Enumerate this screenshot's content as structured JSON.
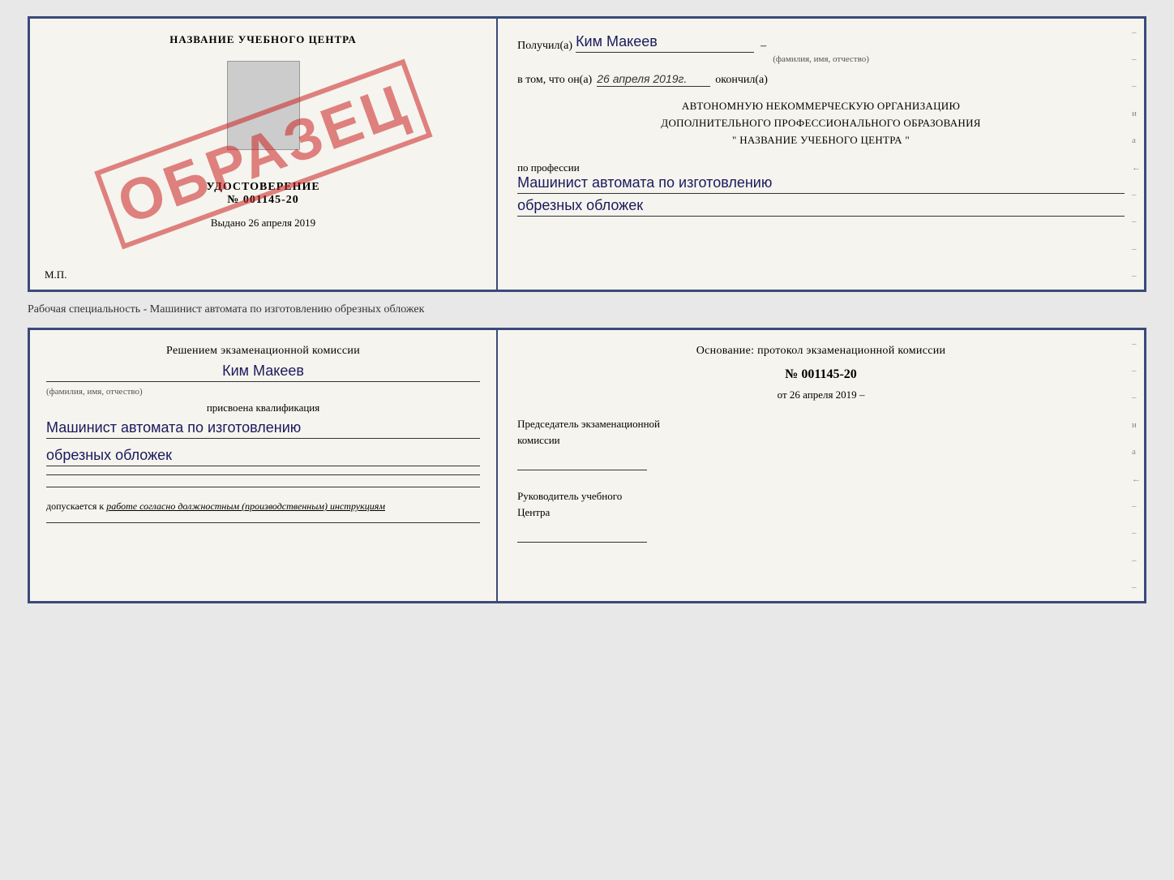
{
  "top_cert": {
    "left": {
      "title": "НАЗВАНИЕ УЧЕБНОГО ЦЕНТРА",
      "stamp_text": "ОБРАЗЕЦ",
      "udostoverenie_label": "УДОСТОВЕРЕНИЕ",
      "number": "№ 001145-20",
      "vydano_prefix": "Выдано",
      "vydano_date": "26 апреля 2019",
      "mp_label": "М.П."
    },
    "right": {
      "poluchil_prefix": "Получил(а)",
      "recipient_name": "Ким Макеев",
      "fio_sub": "(фамилия, имя, отчество)",
      "dash": "–",
      "vtom_prefix": "в том, что он(а)",
      "completed_date": "26 апреля 2019г.",
      "okonchil": "окончил(а)",
      "org_line1": "АВТОНОМНУЮ НЕКОММЕРЧЕСКУЮ ОРГАНИЗАЦИЮ",
      "org_line2": "ДОПОЛНИТЕЛЬНОГО ПРОФЕССИОНАЛЬНОГО ОБРАЗОВАНИЯ",
      "org_name": "\"  НАЗВАНИЕ УЧЕБНОГО ЦЕНТРА  \"",
      "po_professii": "по профессии",
      "profession_line1": "Машинист автомата по изготовлению",
      "profession_line2": "обрезных обложек",
      "sidebar_marks": [
        "–",
        "–",
        "–",
        "и",
        "а",
        "←",
        "–",
        "–",
        "–",
        "–"
      ]
    }
  },
  "specialty_label": "Рабочая специальность - Машинист автомата по изготовлению обрезных обложек",
  "bottom_cert": {
    "left": {
      "resheniem_text": "Решением экзаменационной комиссии",
      "komissia_name": "Ким Макеев",
      "fio_sub": "(фамилия, имя, отчество)",
      "prisvoena": "присвоена квалификация",
      "kvalif_line1": "Машинист автомата по изготовлению",
      "kvalif_line2": "обрезных обложек",
      "dopuskaetsya_prefix": "допускается к",
      "dopuskaetsya_text": "работе согласно должностным (производственным) инструкциям"
    },
    "right": {
      "osnovanie_text": "Основание: протокол экзаменационной комиссии",
      "protocol_label": "№",
      "protocol_number": "001145-20",
      "ot_prefix": "от",
      "ot_date": "26 апреля 2019",
      "predsedatel_line1": "Председатель экзаменационной",
      "predsedatel_line2": "комиссии",
      "rukovoditel_line1": "Руководитель учебного",
      "rukovoditel_line2": "Центра",
      "sidebar_marks": [
        "–",
        "–",
        "–",
        "и",
        "а",
        "←",
        "–",
        "–",
        "–",
        "–"
      ]
    }
  }
}
